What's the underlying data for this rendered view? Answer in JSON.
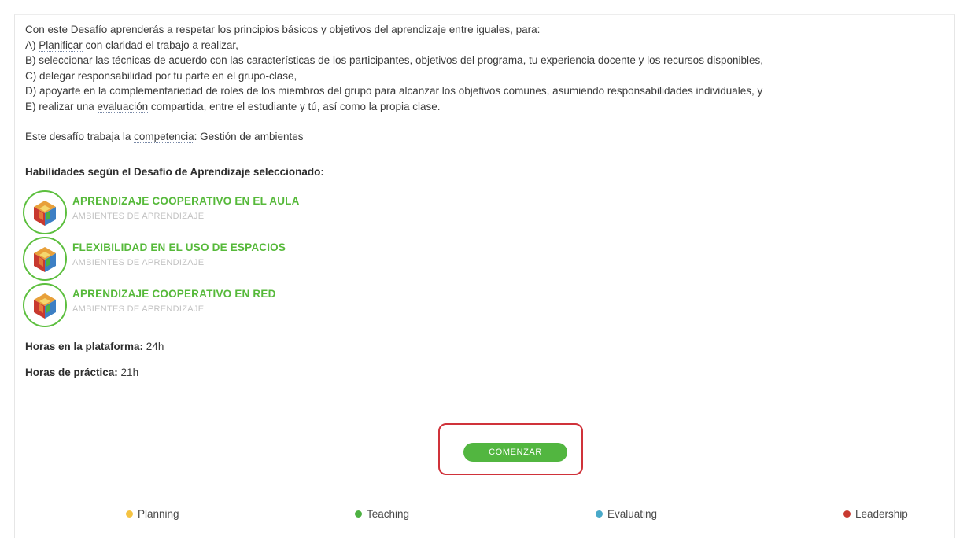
{
  "description": {
    "intro": "Con este Desafío aprenderás a respetar los principios básicos y objetivos del aprendizaje entre iguales, para:",
    "a_prefix": "A) ",
    "a_term": "Planificar",
    "a_rest": " con claridad el trabajo a realizar,",
    "b": "B) seleccionar las técnicas de acuerdo con las características de los participantes, objetivos del programa, tu experiencia docente y los recursos disponibles,",
    "c": "C) delegar responsabilidad por tu parte en el grupo-clase,",
    "d": "D) apoyarte en la complementariedad de roles de los miembros del grupo para alcanzar los objetivos comunes, asumiendo responsabilidades individuales, y",
    "e_prefix": "E) realizar una ",
    "e_term": "evaluación",
    "e_rest": " compartida, entre el estudiante y tú, así como la propia clase."
  },
  "competence": {
    "prefix": "Este desafío trabaja la ",
    "term": "competencia",
    "suffix": ": Gestión de ambientes"
  },
  "skills_title": "Habilidades según el Desafío de Aprendizaje seleccionado:",
  "skills": [
    {
      "name": "APRENDIZAJE COOPERATIVO EN EL AULA",
      "category": "AMBIENTES DE APRENDIZAJE",
      "icon": "cube-icon"
    },
    {
      "name": "FLEXIBILIDAD EN EL USO DE ESPACIOS",
      "category": "AMBIENTES DE APRENDIZAJE",
      "icon": "cube-icon"
    },
    {
      "name": "APRENDIZAJE COOPERATIVO EN RED",
      "category": "AMBIENTES DE APRENDIZAJE",
      "icon": "cube-icon"
    }
  ],
  "hours_platform": {
    "label": "Horas en la plataforma:",
    "value": " 24h"
  },
  "hours_practice": {
    "label": "Horas de práctica:",
    "value": " 21h"
  },
  "start_button": "COMENZAR",
  "legend": [
    {
      "label": "Planning",
      "color": "#f5c342"
    },
    {
      "label": "Teaching",
      "color": "#4db142"
    },
    {
      "label": "Evaluating",
      "color": "#49a9c9"
    },
    {
      "label": "Leadership",
      "color": "#c8392f"
    }
  ],
  "colors": {
    "accent": "#56b93a",
    "highlight": "#d0323a"
  }
}
